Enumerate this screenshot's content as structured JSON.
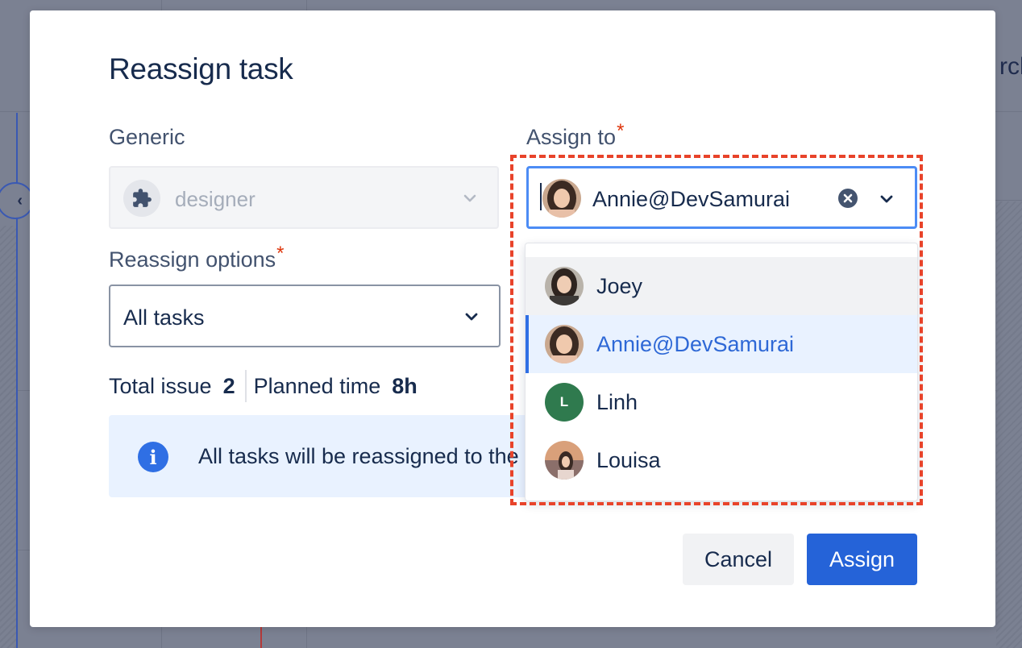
{
  "background": {
    "partial_text": "rch"
  },
  "modal": {
    "title": "Reassign task",
    "generic": {
      "label": "Generic",
      "value": "designer",
      "icon": "puzzle-icon"
    },
    "assign_to": {
      "label": "Assign to",
      "required_mark": "*",
      "value": "Annie@DevSamurai"
    },
    "reassign_options": {
      "label": "Reassign options",
      "required_mark": "*",
      "value": "All tasks"
    },
    "stats": {
      "total_issue_label": "Total issue",
      "total_issue_value": "2",
      "planned_time_label": "Planned time",
      "planned_time_value": "8h"
    },
    "info": {
      "text": "All tasks will be reassigned to the"
    },
    "dropdown": {
      "options": [
        {
          "label": "Joey",
          "state": "hover"
        },
        {
          "label": "Annie@DevSamurai",
          "state": "selected"
        },
        {
          "label": "Linh",
          "state": "default",
          "initial": "L"
        },
        {
          "label": "Louisa",
          "state": "default"
        }
      ]
    },
    "buttons": {
      "cancel": "Cancel",
      "assign": "Assign"
    }
  },
  "colors": {
    "primary": "#2563d8",
    "selected_text": "#2e68d6",
    "required": "#de350b",
    "highlight": "#e8432a",
    "linh_avatar": "#2f7a4e"
  }
}
